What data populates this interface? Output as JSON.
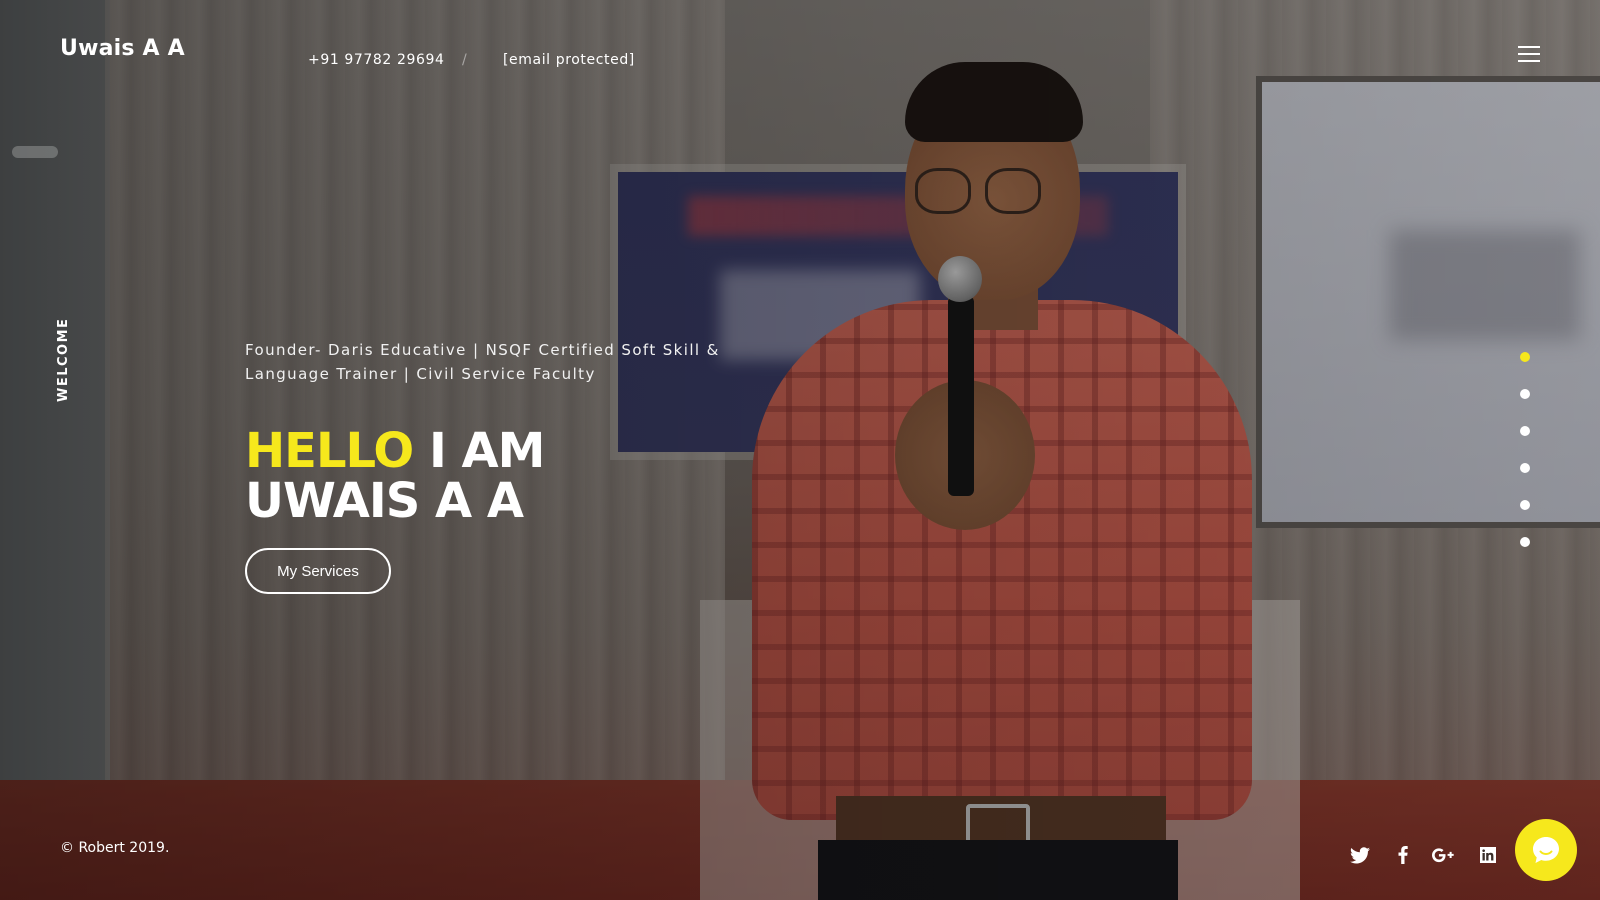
{
  "header": {
    "brand": "Uwais A A",
    "phone": "+91 97782 29694",
    "separator": "/",
    "email": "[email protected]"
  },
  "side": {
    "welcome_label": "WELCOME"
  },
  "hero": {
    "tagline": "Founder- Daris Educative | NSQF Certified Soft Skill & Language Trainer | Civil Service Faculty",
    "title_highlight": "HELLO",
    "title_rest": "I AM",
    "title_name": "UWAIS A A",
    "cta_label": "My Services"
  },
  "slider": {
    "dot_count": 6,
    "active_index": 0
  },
  "footer": {
    "copyright": "© Robert 2019."
  },
  "social": [
    "twitter-icon",
    "facebook-icon",
    "google-plus-icon",
    "linkedin-icon"
  ],
  "colors": {
    "accent": "#f6e81c",
    "text": "#ffffff"
  }
}
